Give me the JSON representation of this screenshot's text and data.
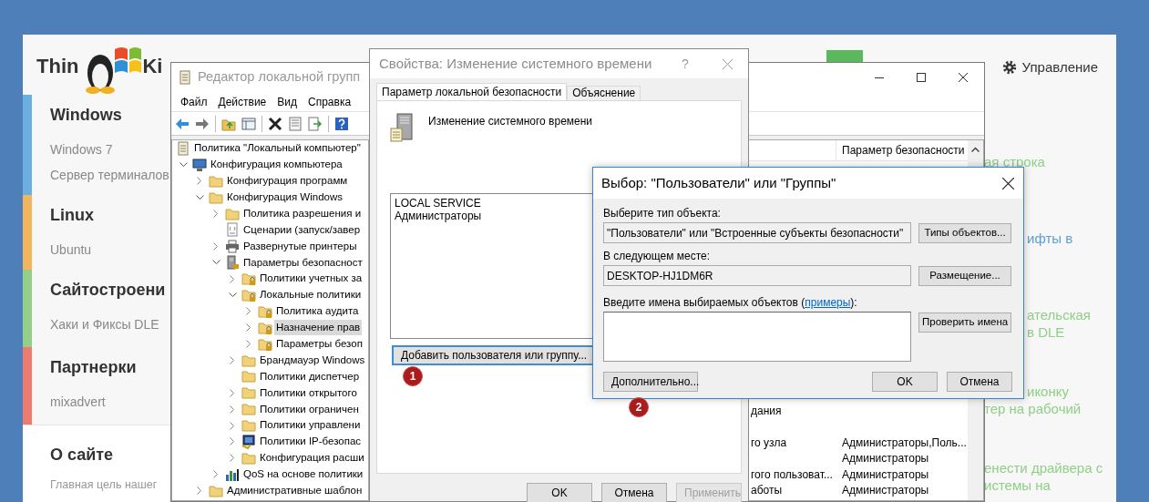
{
  "site": {
    "logo": {
      "left": "Thin",
      "right": "Ki"
    },
    "admin_link": "Управление",
    "sidebar": [
      {
        "title": "Windows",
        "color": "#6aafe0",
        "links": [
          "Windows 7",
          "Сервер терминалов"
        ]
      },
      {
        "title": "Linux",
        "color": "#f2b55e",
        "links": [
          "Ubuntu"
        ]
      },
      {
        "title": "Сайтостроени",
        "color": "#93cf88",
        "links": [
          "Хаки и Фиксы DLE"
        ]
      },
      {
        "title": "Партнерки",
        "color": "#ee7b6e",
        "links": [
          "mixadvert"
        ]
      }
    ],
    "about": {
      "title": "О сайте",
      "text": "Главная цель нашег"
    },
    "articles": [
      {
        "lines": [
          "ая строка"
        ],
        "color": "#8fcf86"
      },
      {
        "lines": [
          "ифты в"
        ],
        "color": "#5a9fd4"
      },
      {
        "lines": [
          "ательская",
          "в DLE"
        ],
        "color": "#8fcf86"
      },
      {
        "lines": [
          "иконку",
          "тер на рабочий"
        ],
        "color": "#8fcf86"
      },
      {
        "lines": [
          "енести драйвера с",
          "истемы на"
        ],
        "color": "#8fcf86"
      }
    ]
  },
  "gpedit": {
    "title": "Редактор локальной групп",
    "menu": [
      "Файл",
      "Действие",
      "Вид",
      "Справка"
    ],
    "tree": [
      {
        "label": "Политика \"Локальный компьютер\"",
        "kind": "policy",
        "selected": false,
        "children": [
          {
            "label": "Конфигурация компьютера",
            "kind": "computer",
            "expanded": true,
            "selected": false,
            "children": [
              {
                "label": "Конфигурация программ",
                "kind": "folder",
                "expanded": false,
                "selected": false
              },
              {
                "label": "Конфигурация Windows",
                "kind": "folder",
                "expanded": true,
                "selected": false,
                "children": [
                  {
                    "label": "Политика разрешения и",
                    "kind": "folder",
                    "expanded": false,
                    "selected": false
                  },
                  {
                    "label": "Сценарии (запуск/завер",
                    "kind": "script",
                    "selected": false
                  },
                  {
                    "label": "Развернутые принтеры",
                    "kind": "printer",
                    "expanded": false,
                    "selected": false
                  },
                  {
                    "label": "Параметры безопасност",
                    "kind": "security",
                    "expanded": true,
                    "selected": false,
                    "children": [
                      {
                        "label": "Политики учетных за",
                        "kind": "folder-lock",
                        "expanded": false,
                        "selected": false
                      },
                      {
                        "label": "Локальные политики",
                        "kind": "folder-lock",
                        "expanded": true,
                        "selected": false,
                        "children": [
                          {
                            "label": "Политика аудита",
                            "kind": "folder-lock",
                            "expanded": false,
                            "selected": false
                          },
                          {
                            "label": "Назначение прав",
                            "kind": "folder-lock",
                            "expanded": false,
                            "selected": true
                          },
                          {
                            "label": "Параметры безоп",
                            "kind": "folder-lock",
                            "expanded": false,
                            "selected": false
                          }
                        ]
                      },
                      {
                        "label": "Брандмауэр Windows",
                        "kind": "folder",
                        "expanded": false,
                        "selected": false
                      },
                      {
                        "label": "Политики диспетчер",
                        "kind": "folder",
                        "selected": false
                      },
                      {
                        "label": "Политики открытого",
                        "kind": "folder",
                        "expanded": false,
                        "selected": false
                      },
                      {
                        "label": "Политики ограничен",
                        "kind": "folder",
                        "expanded": false,
                        "selected": false
                      },
                      {
                        "label": "Политики управлени",
                        "kind": "folder",
                        "expanded": false,
                        "selected": false
                      },
                      {
                        "label": "Политики IP-безопас",
                        "kind": "ip",
                        "expanded": false,
                        "selected": false
                      },
                      {
                        "label": "Конфигурация расши",
                        "kind": "folder",
                        "expanded": false,
                        "selected": false
                      }
                    ]
                  },
                  {
                    "label": "QoS на основе политики",
                    "kind": "qos",
                    "expanded": false,
                    "selected": false
                  }
                ]
              },
              {
                "label": "Административные шаблон",
                "kind": "folder",
                "expanded": false,
                "selected": false
              }
            ]
          }
        ]
      }
    ],
    "column": "Параметр безопасности",
    "rows": [
      {
        "name": "дания"
      },
      {},
      {
        "name": "го узла",
        "setting": "Администраторы,Поль..."
      },
      {
        "setting": "Администраторы"
      },
      {
        "name": "гого пользоват...",
        "setting": "Администраторы"
      },
      {
        "name": "аботы",
        "setting": "Администраторы"
      }
    ]
  },
  "properties": {
    "title": "Свойства: Изменение системного времени",
    "help": "?",
    "tabs": [
      {
        "label": "Параметр локальной безопасности",
        "selected": true
      },
      {
        "label": "Объяснение",
        "selected": false
      }
    ],
    "policy": "Изменение системного времени",
    "members": [
      "LOCAL SERVICE",
      "Администраторы"
    ],
    "add_button": "Добавить пользователя или группу...",
    "buttons": [
      {
        "label": "OK",
        "disabled": false
      },
      {
        "label": "Отмена",
        "disabled": false
      },
      {
        "label": "Применить",
        "disabled": true
      }
    ]
  },
  "select_dialog": {
    "title": "Выбор: \"Пользователи\" или \"Группы\"",
    "object_type_label": "Выберите тип объекта:",
    "object_type": "\"Пользователи\" или \"Встроенные субъекты безопасности\"",
    "object_types_button": "Типы объектов...",
    "location_label": "В следующем месте:",
    "location": "DESKTOP-HJ1DM6R",
    "location_button": "Размещение...",
    "names_label": "Введите имена выбираемых объектов (",
    "names_link": "примеры",
    "names_label_end": "):",
    "check_button": "Проверить имена",
    "advanced_button": "Дополнительно...",
    "ok_button": "OK",
    "cancel_button": "Отмена"
  },
  "markers": [
    "1",
    "2"
  ]
}
